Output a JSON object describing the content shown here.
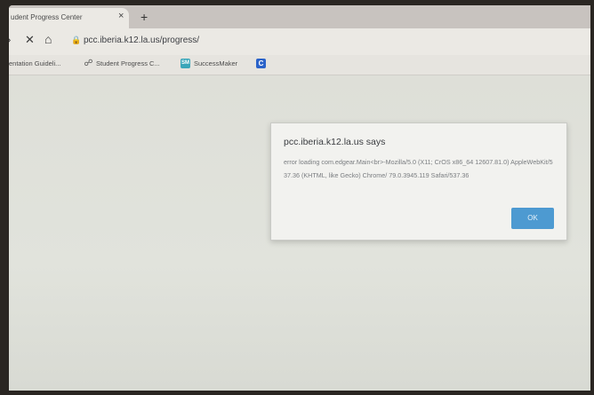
{
  "browser": {
    "tab": {
      "title": "udent Progress Center",
      "close_glyph": "×"
    },
    "new_tab_glyph": "+",
    "toolbar": {
      "back_glyph": "›",
      "close_glyph": "✕",
      "home_glyph": "⌂",
      "lock_glyph": "🔒",
      "url": "pcc.iberia.k12.la.us/progress/"
    },
    "bookmarks": [
      {
        "label": "entation Guideli...",
        "icon": "none"
      },
      {
        "label": "Student Progress C...",
        "icon": "student-progress-icon"
      },
      {
        "label": "SuccessMaker",
        "icon": "successmaker-icon"
      },
      {
        "label": "",
        "icon": "c-bookmark-icon"
      }
    ]
  },
  "dialog": {
    "title": "pcc.iberia.k12.la.us says",
    "message": "error loading com.edgear.Main<br>-Mozilla/5.0 (X11; CrOS x86_64 12607.81.0) AppleWebKit/537.36 (KHTML, like Gecko) Chrome/ 79.0.3945.119 Safari/537.36",
    "ok_label": "OK"
  },
  "icons": {
    "successmaker_text": "SM",
    "c_text": "C",
    "student_progress_glyph": "☍"
  },
  "colors": {
    "ok_button": "#4d9ad1",
    "page_background": "#dfe0d9",
    "c_bookmark": "#2b63c9",
    "successmaker": "#3aa6b9"
  }
}
